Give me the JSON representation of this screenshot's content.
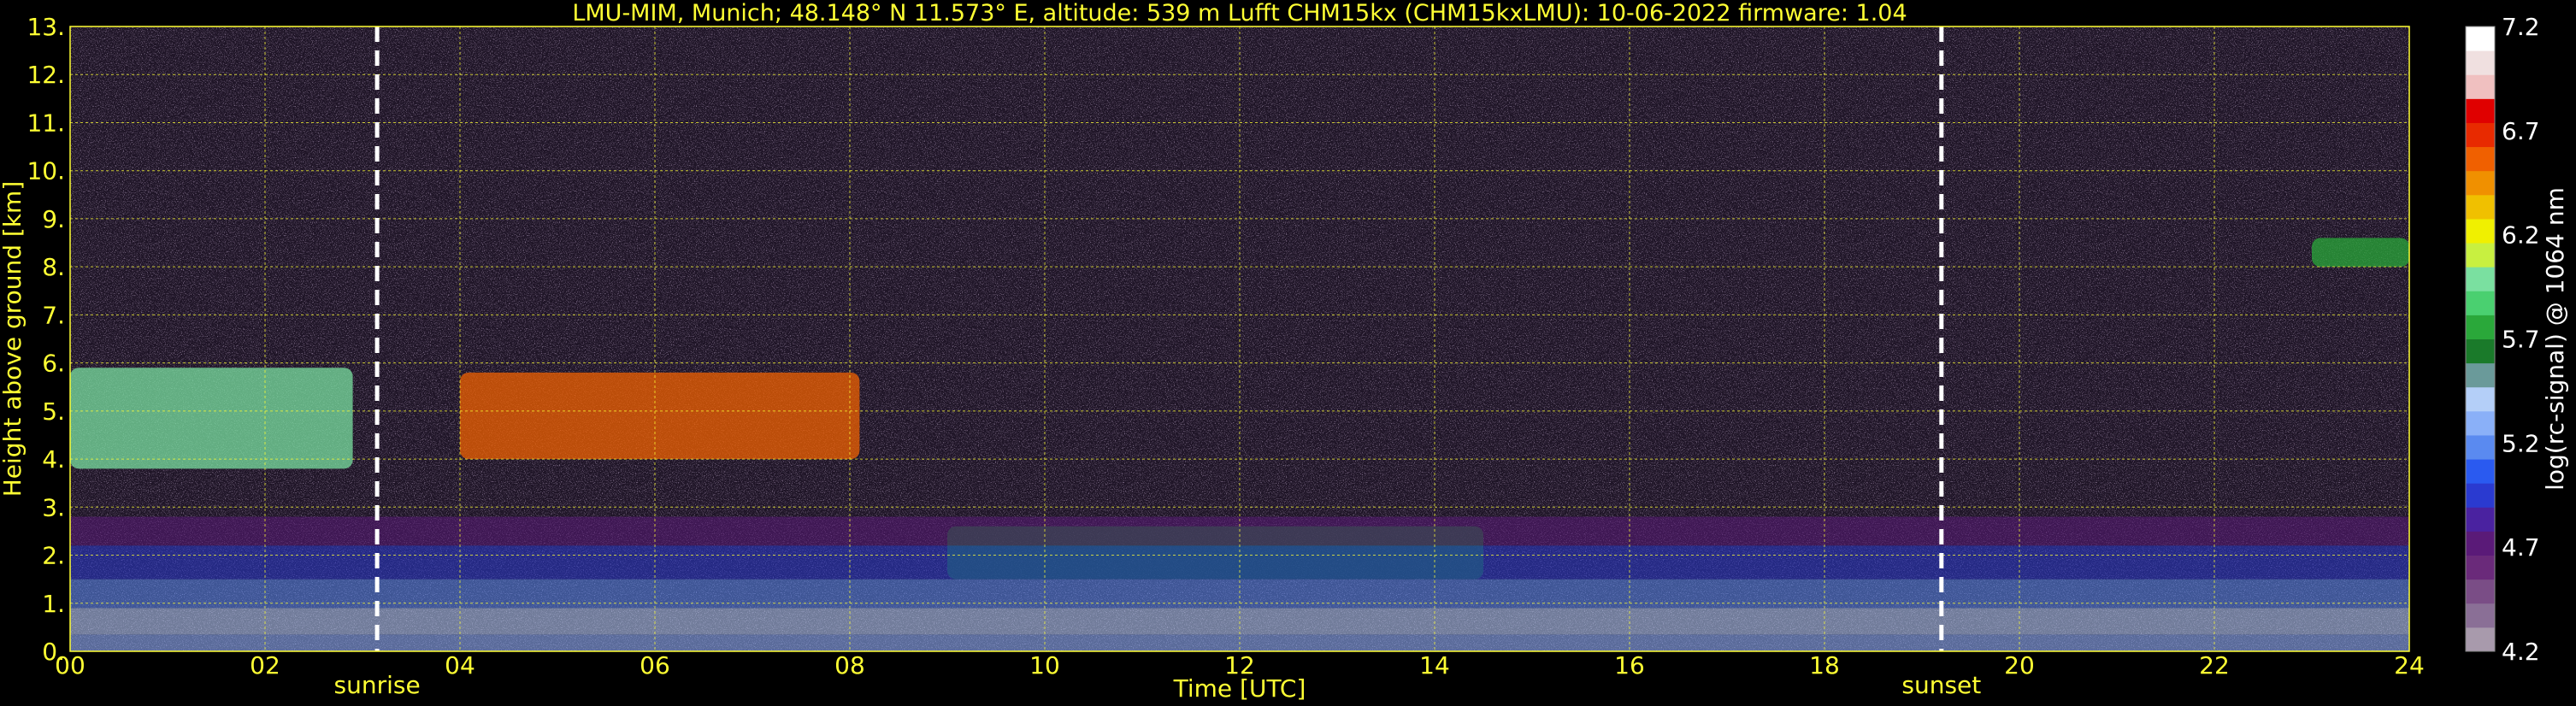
{
  "chart_data": {
    "type": "heatmap",
    "title": "LMU-MIM, Munich; 48.148° N 11.573° E, altitude: 539 m    Lufft CHM15kx (CHM15kxLMU): 10-06-2022    firmware: 1.04",
    "xlabel": "Time [UTC]",
    "ylabel": "Height above ground [km]",
    "xlim": [
      0,
      24
    ],
    "ylim": [
      0,
      13
    ],
    "x_ticks": [
      "00",
      "02",
      "04",
      "06",
      "08",
      "10",
      "12",
      "14",
      "16",
      "18",
      "20",
      "22",
      "24"
    ],
    "x_tick_values": [
      0,
      2,
      4,
      6,
      8,
      10,
      12,
      14,
      16,
      18,
      20,
      22,
      24
    ],
    "y_ticks": [
      "0.",
      "1.",
      "2.",
      "3.",
      "4.",
      "5.",
      "6.",
      "7.",
      "8.",
      "9.",
      "10.",
      "11.",
      "12.",
      "13."
    ],
    "y_tick_values": [
      0,
      1,
      2,
      3,
      4,
      5,
      6,
      7,
      8,
      9,
      10,
      11,
      12,
      13
    ],
    "grid": true,
    "events": [
      {
        "label": "sunrise",
        "time": 3.15
      },
      {
        "label": "sunset",
        "time": 19.2
      }
    ],
    "colorbar": {
      "label": "log(rc-signal) @ 1064 nm",
      "range": [
        4.2,
        7.2
      ],
      "tick_labels": [
        "4.2",
        "4.7",
        "5.2",
        "5.7",
        "6.2",
        "6.7",
        "7.2"
      ],
      "tick_values": [
        4.2,
        4.7,
        5.2,
        5.7,
        6.2,
        6.7,
        7.2
      ],
      "colors": [
        "#a89aac",
        "#8a6f96",
        "#7a4d86",
        "#6a2a7a",
        "#5a1a78",
        "#4a22a0",
        "#2a3ad0",
        "#2a5af0",
        "#5a8af0",
        "#8ab0f8",
        "#b4cff8",
        "#6a9a9a",
        "#1a7a2a",
        "#2aa83a",
        "#4ad070",
        "#7ae0a0",
        "#c8f040",
        "#f0f000",
        "#f0c000",
        "#f09000",
        "#f06000",
        "#e82a00",
        "#e00000",
        "#f0c0c0",
        "#f0e0e0",
        "#ffffff"
      ]
    },
    "features": [
      {
        "type": "cloud_layer",
        "x": [
          0,
          2.9
        ],
        "y": [
          3.8,
          5.9
        ],
        "mean_value": 6.0
      },
      {
        "type": "cloud_layer",
        "x": [
          4.0,
          8.1
        ],
        "y": [
          4.0,
          5.8
        ],
        "mean_value": 6.6
      },
      {
        "type": "boundary_layer_top",
        "x": [
          9.0,
          14.5
        ],
        "y": [
          1.5,
          2.6
        ],
        "mean_value": 5.6
      },
      {
        "type": "aerosol_layer",
        "x": [
          0,
          24
        ],
        "y": [
          0,
          2.8
        ],
        "mean_value": 5.0
      },
      {
        "type": "cirrus",
        "x": [
          23.0,
          24.0
        ],
        "y": [
          8.0,
          8.6
        ],
        "mean_value": 5.8
      }
    ]
  }
}
